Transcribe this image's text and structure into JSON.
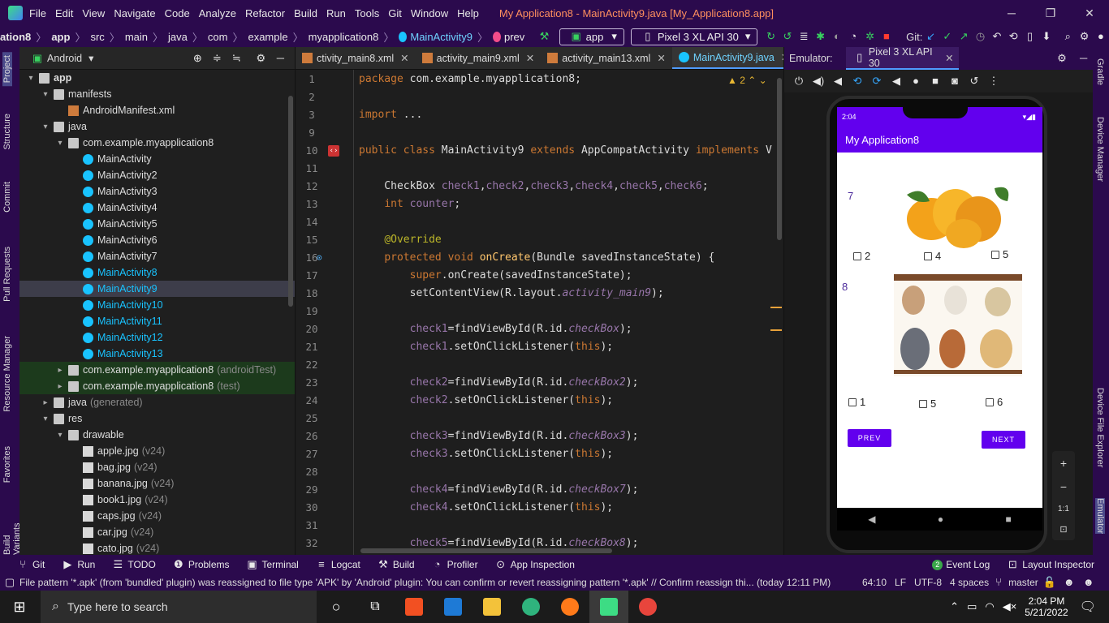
{
  "menubar": {
    "items": [
      "File",
      "Edit",
      "View",
      "Navigate",
      "Code",
      "Analyze",
      "Refactor",
      "Build",
      "Run",
      "Tools",
      "Git",
      "Window",
      "Help"
    ],
    "title": "My Application8 - MainActivity9.java [My_Application8.app]"
  },
  "navbar": {
    "crumbs": [
      "ation8",
      "app",
      "src",
      "main",
      "java",
      "com",
      "example",
      "myapplication8",
      "MainActivity9",
      "prev"
    ],
    "run_config": "app",
    "device": "Pixel 3 XL API 30",
    "git_label": "Git:"
  },
  "leftstrip": [
    "Project",
    "Structure",
    "Commit",
    "Pull Requests",
    "Resource Manager",
    "Favorites",
    "Build Variants"
  ],
  "rightstrip": [
    "Gradle",
    "Device Manager",
    "Device File Explorer",
    "Emulator"
  ],
  "project": {
    "view": "Android",
    "tree": [
      {
        "label": "app",
        "depth": 0,
        "arrow": "▾",
        "icon": "fold",
        "bold": true
      },
      {
        "label": "manifests",
        "depth": 1,
        "arrow": "▾",
        "icon": "fold"
      },
      {
        "label": "AndroidManifest.xml",
        "depth": 2,
        "arrow": "",
        "icon": "xml"
      },
      {
        "label": "java",
        "depth": 1,
        "arrow": "▾",
        "icon": "fold"
      },
      {
        "label": "com.example.myapplication8",
        "depth": 2,
        "arrow": "▾",
        "icon": "pkg"
      },
      {
        "label": "MainActivity",
        "depth": 3,
        "arrow": "",
        "icon": "cls"
      },
      {
        "label": "MainActivity2",
        "depth": 3,
        "arrow": "",
        "icon": "cls"
      },
      {
        "label": "MainActivity3",
        "depth": 3,
        "arrow": "",
        "icon": "cls"
      },
      {
        "label": "MainActivity4",
        "depth": 3,
        "arrow": "",
        "icon": "cls"
      },
      {
        "label": "MainActivity5",
        "depth": 3,
        "arrow": "",
        "icon": "cls"
      },
      {
        "label": "MainActivity6",
        "depth": 3,
        "arrow": "",
        "icon": "cls"
      },
      {
        "label": "MainActivity7",
        "depth": 3,
        "arrow": "",
        "icon": "cls"
      },
      {
        "label": "MainActivity8",
        "depth": 3,
        "arrow": "",
        "icon": "cls",
        "hl": true
      },
      {
        "label": "MainActivity9",
        "depth": 3,
        "arrow": "",
        "icon": "cls",
        "hl": true,
        "sel": true
      },
      {
        "label": "MainActivity10",
        "depth": 3,
        "arrow": "",
        "icon": "cls",
        "hl": true
      },
      {
        "label": "MainActivity11",
        "depth": 3,
        "arrow": "",
        "icon": "cls",
        "hl": true
      },
      {
        "label": "MainActivity12",
        "depth": 3,
        "arrow": "",
        "icon": "cls",
        "hl": true
      },
      {
        "label": "MainActivity13",
        "depth": 3,
        "arrow": "",
        "icon": "cls",
        "hl": true
      },
      {
        "label": "com.example.myapplication8",
        "depth": 2,
        "arrow": "▸",
        "icon": "pkg",
        "dim": "(androidTest)",
        "test": true
      },
      {
        "label": "com.example.myapplication8",
        "depth": 2,
        "arrow": "▸",
        "icon": "pkg",
        "dim": "(test)",
        "test": true
      },
      {
        "label": "java",
        "depth": 1,
        "arrow": "▸",
        "icon": "fold",
        "dim": "(generated)"
      },
      {
        "label": "res",
        "depth": 1,
        "arrow": "▾",
        "icon": "fold"
      },
      {
        "label": "drawable",
        "depth": 2,
        "arrow": "▾",
        "icon": "fold"
      },
      {
        "label": "apple.jpg",
        "depth": 3,
        "arrow": "",
        "icon": "img",
        "dim": "(v24)"
      },
      {
        "label": "bag.jpg",
        "depth": 3,
        "arrow": "",
        "icon": "img",
        "dim": "(v24)"
      },
      {
        "label": "banana.jpg",
        "depth": 3,
        "arrow": "",
        "icon": "img",
        "dim": "(v24)"
      },
      {
        "label": "book1.jpg",
        "depth": 3,
        "arrow": "",
        "icon": "img",
        "dim": "(v24)"
      },
      {
        "label": "caps.jpg",
        "depth": 3,
        "arrow": "",
        "icon": "img",
        "dim": "(v24)"
      },
      {
        "label": "car.jpg",
        "depth": 3,
        "arrow": "",
        "icon": "img",
        "dim": "(v24)"
      },
      {
        "label": "cato.jpg",
        "depth": 3,
        "arrow": "",
        "icon": "img",
        "dim": "(v24)"
      }
    ]
  },
  "editor": {
    "tabs": [
      {
        "label": "ctivity_main8.xml",
        "icon": "xml"
      },
      {
        "label": "activity_main9.xml",
        "icon": "xml"
      },
      {
        "label": "activity_main13.xml",
        "icon": "xml"
      },
      {
        "label": "MainActivity9.java",
        "icon": "cls",
        "active": true
      }
    ],
    "warnings": "2",
    "lines": [
      {
        "n": "1",
        "html": "<span class='kw'>package</span> com.example.myapplication8;"
      },
      {
        "n": "2",
        "html": ""
      },
      {
        "n": "3",
        "html": "<span class='kw'>import</span> ..."
      },
      {
        "n": "9",
        "html": ""
      },
      {
        "n": "10",
        "html": "<span class='kw'>public class</span> MainActivity9 <span class='kw'>extends</span> AppCompatActivity <span class='kw'>implements</span> V"
      },
      {
        "n": "11",
        "html": ""
      },
      {
        "n": "12",
        "html": "    CheckBox <span class='vr'>check1</span>,<span class='vr'>check2</span>,<span class='vr'>check3</span>,<span class='vr'>check4</span>,<span class='vr'>check5</span>,<span class='vr'>check6</span>;"
      },
      {
        "n": "13",
        "html": "    <span class='kw'>int</span> <span class='vr'>counter</span>;"
      },
      {
        "n": "14",
        "html": ""
      },
      {
        "n": "15",
        "html": "    <span class='an'>@Override</span>"
      },
      {
        "n": "16",
        "html": "    <span class='kw'>protected void</span> <span class='fn'>onCreate</span>(Bundle savedInstanceState) {"
      },
      {
        "n": "17",
        "html": "        <span class='kw'>super</span>.onCreate(savedInstanceState);"
      },
      {
        "n": "18",
        "html": "        setContentView(R.layout.<span class='it'>activity_main9</span>);"
      },
      {
        "n": "19",
        "html": ""
      },
      {
        "n": "20",
        "html": "        <span class='vr'>check1</span>=findViewById(R.id.<span class='it'>checkBox</span>);"
      },
      {
        "n": "21",
        "html": "        <span class='vr'>check1</span>.setOnClickListener(<span class='kw'>this</span>);"
      },
      {
        "n": "22",
        "html": ""
      },
      {
        "n": "23",
        "html": "        <span class='vr'>check2</span>=findViewById(R.id.<span class='it'>checkBox2</span>);"
      },
      {
        "n": "24",
        "html": "        <span class='vr'>check2</span>.setOnClickListener(<span class='kw'>this</span>);"
      },
      {
        "n": "25",
        "html": ""
      },
      {
        "n": "26",
        "html": "        <span class='vr'>check3</span>=findViewById(R.id.<span class='it'>checkBox3</span>);"
      },
      {
        "n": "27",
        "html": "        <span class='vr'>check3</span>.setOnClickListener(<span class='kw'>this</span>);"
      },
      {
        "n": "28",
        "html": ""
      },
      {
        "n": "29",
        "html": "        <span class='vr'>check4</span>=findViewById(R.id.<span class='it'>checkBox7</span>);"
      },
      {
        "n": "30",
        "html": "        <span class='vr'>check4</span>.setOnClickListener(<span class='kw'>this</span>);"
      },
      {
        "n": "31",
        "html": ""
      },
      {
        "n": "32",
        "html": "        <span class='vr'>check5</span>=findViewById(R.id.<span class='it'>checkBox8</span>);"
      }
    ]
  },
  "emulator": {
    "label": "Emulator:",
    "tab": "Pixel 3 XL API 30",
    "phone": {
      "time": "2:04",
      "app_title": "My Application8",
      "q1_number": "7",
      "q1_options": [
        "2",
        "4",
        "5"
      ],
      "q2_number": "8",
      "q2_options": [
        "1",
        "5",
        "6"
      ],
      "prev": "PREV",
      "next": "NEXT"
    },
    "zoom": [
      "+",
      "−",
      "1:1",
      "⊡"
    ]
  },
  "bottombar": {
    "left": [
      "Git",
      "Run",
      "TODO",
      "Problems",
      "Terminal",
      "Logcat",
      "Build",
      "Profiler",
      "App Inspection"
    ],
    "right": [
      "Event Log",
      "Layout Inspector"
    ],
    "event_count": "2"
  },
  "statusbar": {
    "message": "File pattern '*.apk' (from 'bundled' plugin) was reassigned to file type 'APK' by 'Android' plugin: You can confirm or revert reassigning pattern '*.apk' // Confirm reassign thi... (today 12:11 PM)",
    "position": "64:10",
    "line_sep": "LF",
    "encoding": "UTF-8",
    "indent": "4 spaces",
    "branch": "master"
  },
  "taskbar": {
    "search_placeholder": "Type here to search",
    "time": "2:04 PM",
    "date": "5/21/2022"
  }
}
